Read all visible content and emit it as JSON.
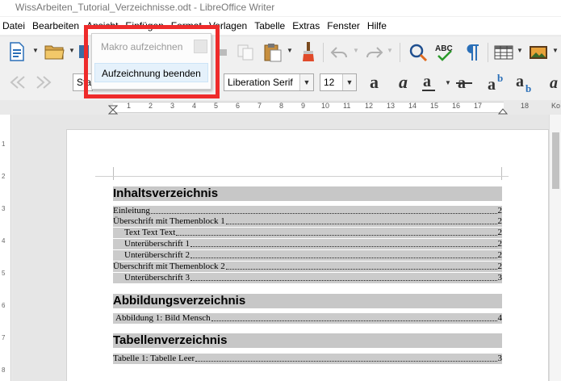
{
  "window": {
    "title": "WissArbeiten_Tutorial_Verzeichnisse.odt - LibreOffice Writer"
  },
  "menubar": {
    "items": [
      "Datei",
      "Bearbeiten",
      "Ansicht",
      "Einfügen",
      "Format",
      "Vorlagen",
      "Tabelle",
      "Extras",
      "Fenster",
      "Hilfe"
    ]
  },
  "toolbar": {
    "style_name": "Sta",
    "font_name": "Liberation Serif",
    "font_size": "12"
  },
  "macro_menu": {
    "record_label": "Makro aufzeichnen",
    "stop_label": "Aufzeichnung beenden"
  },
  "ruler": {
    "numbers": [
      "1",
      "2",
      "3",
      "4",
      "5",
      "6",
      "7",
      "8",
      "9",
      "10",
      "11",
      "12",
      "13",
      "14",
      "15",
      "16",
      "17",
      "18"
    ],
    "tail": "Ko",
    "vertical_numbers": [
      "1",
      "2",
      "3",
      "4",
      "5",
      "6",
      "7",
      "8"
    ]
  },
  "document": {
    "toc_title": "Inhaltsverzeichnis",
    "toc_entries": [
      {
        "text": "Einleitung",
        "page": "2"
      },
      {
        "text": "Überschrift mit Themenblock 1",
        "page": "2"
      },
      {
        "text": "Text Text Text",
        "page": "2"
      },
      {
        "text": "Unterüberschrift 1",
        "page": "2"
      },
      {
        "text": "Unterüberschrift 2",
        "page": "2"
      },
      {
        "text": "Überschrift mit Themenblock 2",
        "page": "2"
      },
      {
        "text": "Unterüberschrift 3",
        "page": "3"
      }
    ],
    "figures_title": "Abbildungsverzeichnis",
    "figure_entries": [
      {
        "text": "Abbildung 1: Bild Mensch",
        "page": "4"
      }
    ],
    "tables_title": "Tabellenverzeichnis",
    "table_entries": [
      {
        "text": "Tabelle 1: Tabelle Leer",
        "page": "3"
      }
    ]
  },
  "colors": {
    "highlight": "#ee2b2b",
    "index_shading": "#c7c7c7",
    "menu_active": "#e5f1fb"
  }
}
